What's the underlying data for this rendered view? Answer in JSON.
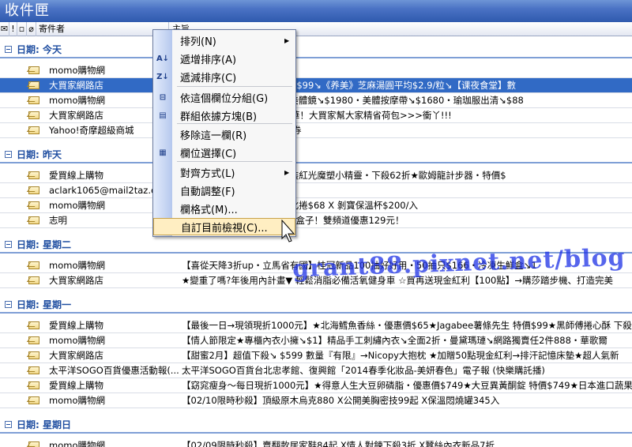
{
  "window": {
    "title": "收件匣"
  },
  "columns": {
    "sender": "寄件者",
    "subject": "主旨"
  },
  "groups": [
    {
      "label": "日期: 今天",
      "rows": [
        {
          "sender": "momo購物網",
          "subject": ""
        },
        {
          "sender": "大買家網路店",
          "subject": "旺厄府】桂冠湯圓3盒装特惠$99↘《养美》芝麻湯圓平均$2.9/粒↘【课夜食堂】數",
          "selected": true
        },
        {
          "sender": "momo購物網",
          "subject": "美人椅↘$2980・貝殼鏡+美體鏡↘$1980・美體按摩帶↘$1680・瑜珈服出清↘$88"
        },
        {
          "sender": "大買家網路店",
          "subject": "ＯＯ折價券，進口品牌嘉年華！大買家幫大家精省荷包>>>衝丫!!!"
        },
        {
          "sender": "Yahoo!奇摩超級商城",
          "subject": "爛春全館慶★現享20元折價券"
        }
      ]
    },
    {
      "label": "日期: 昨天",
      "rows": [
        {
          "sender": "愛買線上購物",
          "subject": "果美番茄汁・買一送一★罐裝紅光魔塑小精靈・下殺62折★歐姆龍計步器・特價$"
        },
        {
          "sender": "aclark1065@mail2taz.com",
          "subject": "vants duringnights?"
        },
        {
          "sender": "momo購物網",
          "subject": "紙$8.3/包 X 爆漿巧克力威化捲$68 X 剝寶保溫杯$200/入"
        },
        {
          "sender": "志明",
          "subject": "報！打開bbTV潘朵啦的數位盒子！雙頻道優惠129元！"
        }
      ]
    },
    {
      "label": "日期: 星期二",
      "rows": [
        {
          "sender": "momo購物網",
          "subject": "【喜從天降3折up・立馬省有國】桂冠新品100抽好好用・50抽只$166・冷凍生鮮盒↘1"
        },
        {
          "sender": "大買家網路店",
          "subject": "★變重了嗎?年後用內計畫▼ 輕鬆消脂必備活氧健身車 ☆買再送現金紅利【100點】→購莎踏步機、打造完美"
        }
      ]
    },
    {
      "label": "日期: 星期一",
      "rows": [
        {
          "sender": "愛買線上購物",
          "subject": "【最後一日→現領現折1000元】★北海鱈魚香絲・優惠價$65★Jagabee薯條先生 特價$99★黑師傅捲心酥 下殺"
        },
        {
          "sender": "momo購物網",
          "subject": "【情人節限定★專櫃內衣小擁↘$1】精品手工刺繡內衣↘全面2折・曼黛瑪璉↘網路獨賣任2件888・華歌爾"
        },
        {
          "sender": "大買家網路店",
          "subject": "【甜蜜2月】超值下殺↘ $599 數量『有限』→Nicopy大抱枕 ★加贈50點現金紅利→排汗記憶床墊★超人氣新"
        },
        {
          "sender": "太平洋SOGO百貨優惠活動報(...",
          "subject": "太平洋SOGO百貨台北忠孝館、復興館「2014春季化妝品-美妍春色」電子報 (快樂購託播)"
        },
        {
          "sender": "愛買線上購物",
          "subject": "【窈窕瘦身～每日現折1000元】★得意人生大豆卵磷脂・優惠價$749★大豆異黃酮錠 特價$749★日本進口蔬果"
        },
        {
          "sender": "momo購物網",
          "subject": "【02/10限時秒殺】頂級原木烏克880 X公開美胸密技99起 X保溫悶燒罐345入"
        }
      ]
    },
    {
      "label": "日期: 星期日",
      "rows": [
        {
          "sender": "momo購物網",
          "subject": "【02/09限時秒殺】賣翻款居家鞋84起 X情人對鍊下殺3折 X蠶絲內衣新品7折"
        }
      ]
    }
  ],
  "context_menu": {
    "items": [
      {
        "label": "排列(N)",
        "icon": "",
        "submenu": true
      },
      {
        "label": "遞增排序(A)",
        "icon": "sort-ascending-icon"
      },
      {
        "label": "遞減排序(C)",
        "icon": "sort-descending-icon"
      },
      {
        "label": "依這個欄位分組(G)",
        "icon": "group-by-field-icon"
      },
      {
        "label": "群組依據方塊(B)",
        "icon": "group-box-icon"
      },
      {
        "label": "移除這一欄(R)",
        "icon": ""
      },
      {
        "label": "欄位選擇(C)",
        "icon": "field-chooser-icon"
      },
      {
        "label": "對齊方式(L)",
        "icon": "",
        "submenu": true
      },
      {
        "label": "自動調整(F)",
        "icon": ""
      },
      {
        "label": "欄格式(M)...",
        "icon": ""
      },
      {
        "label": "自訂目前檢視(C)...",
        "icon": "",
        "highlighted": true
      }
    ]
  },
  "watermark": "grant88.pixnet.net/blog"
}
